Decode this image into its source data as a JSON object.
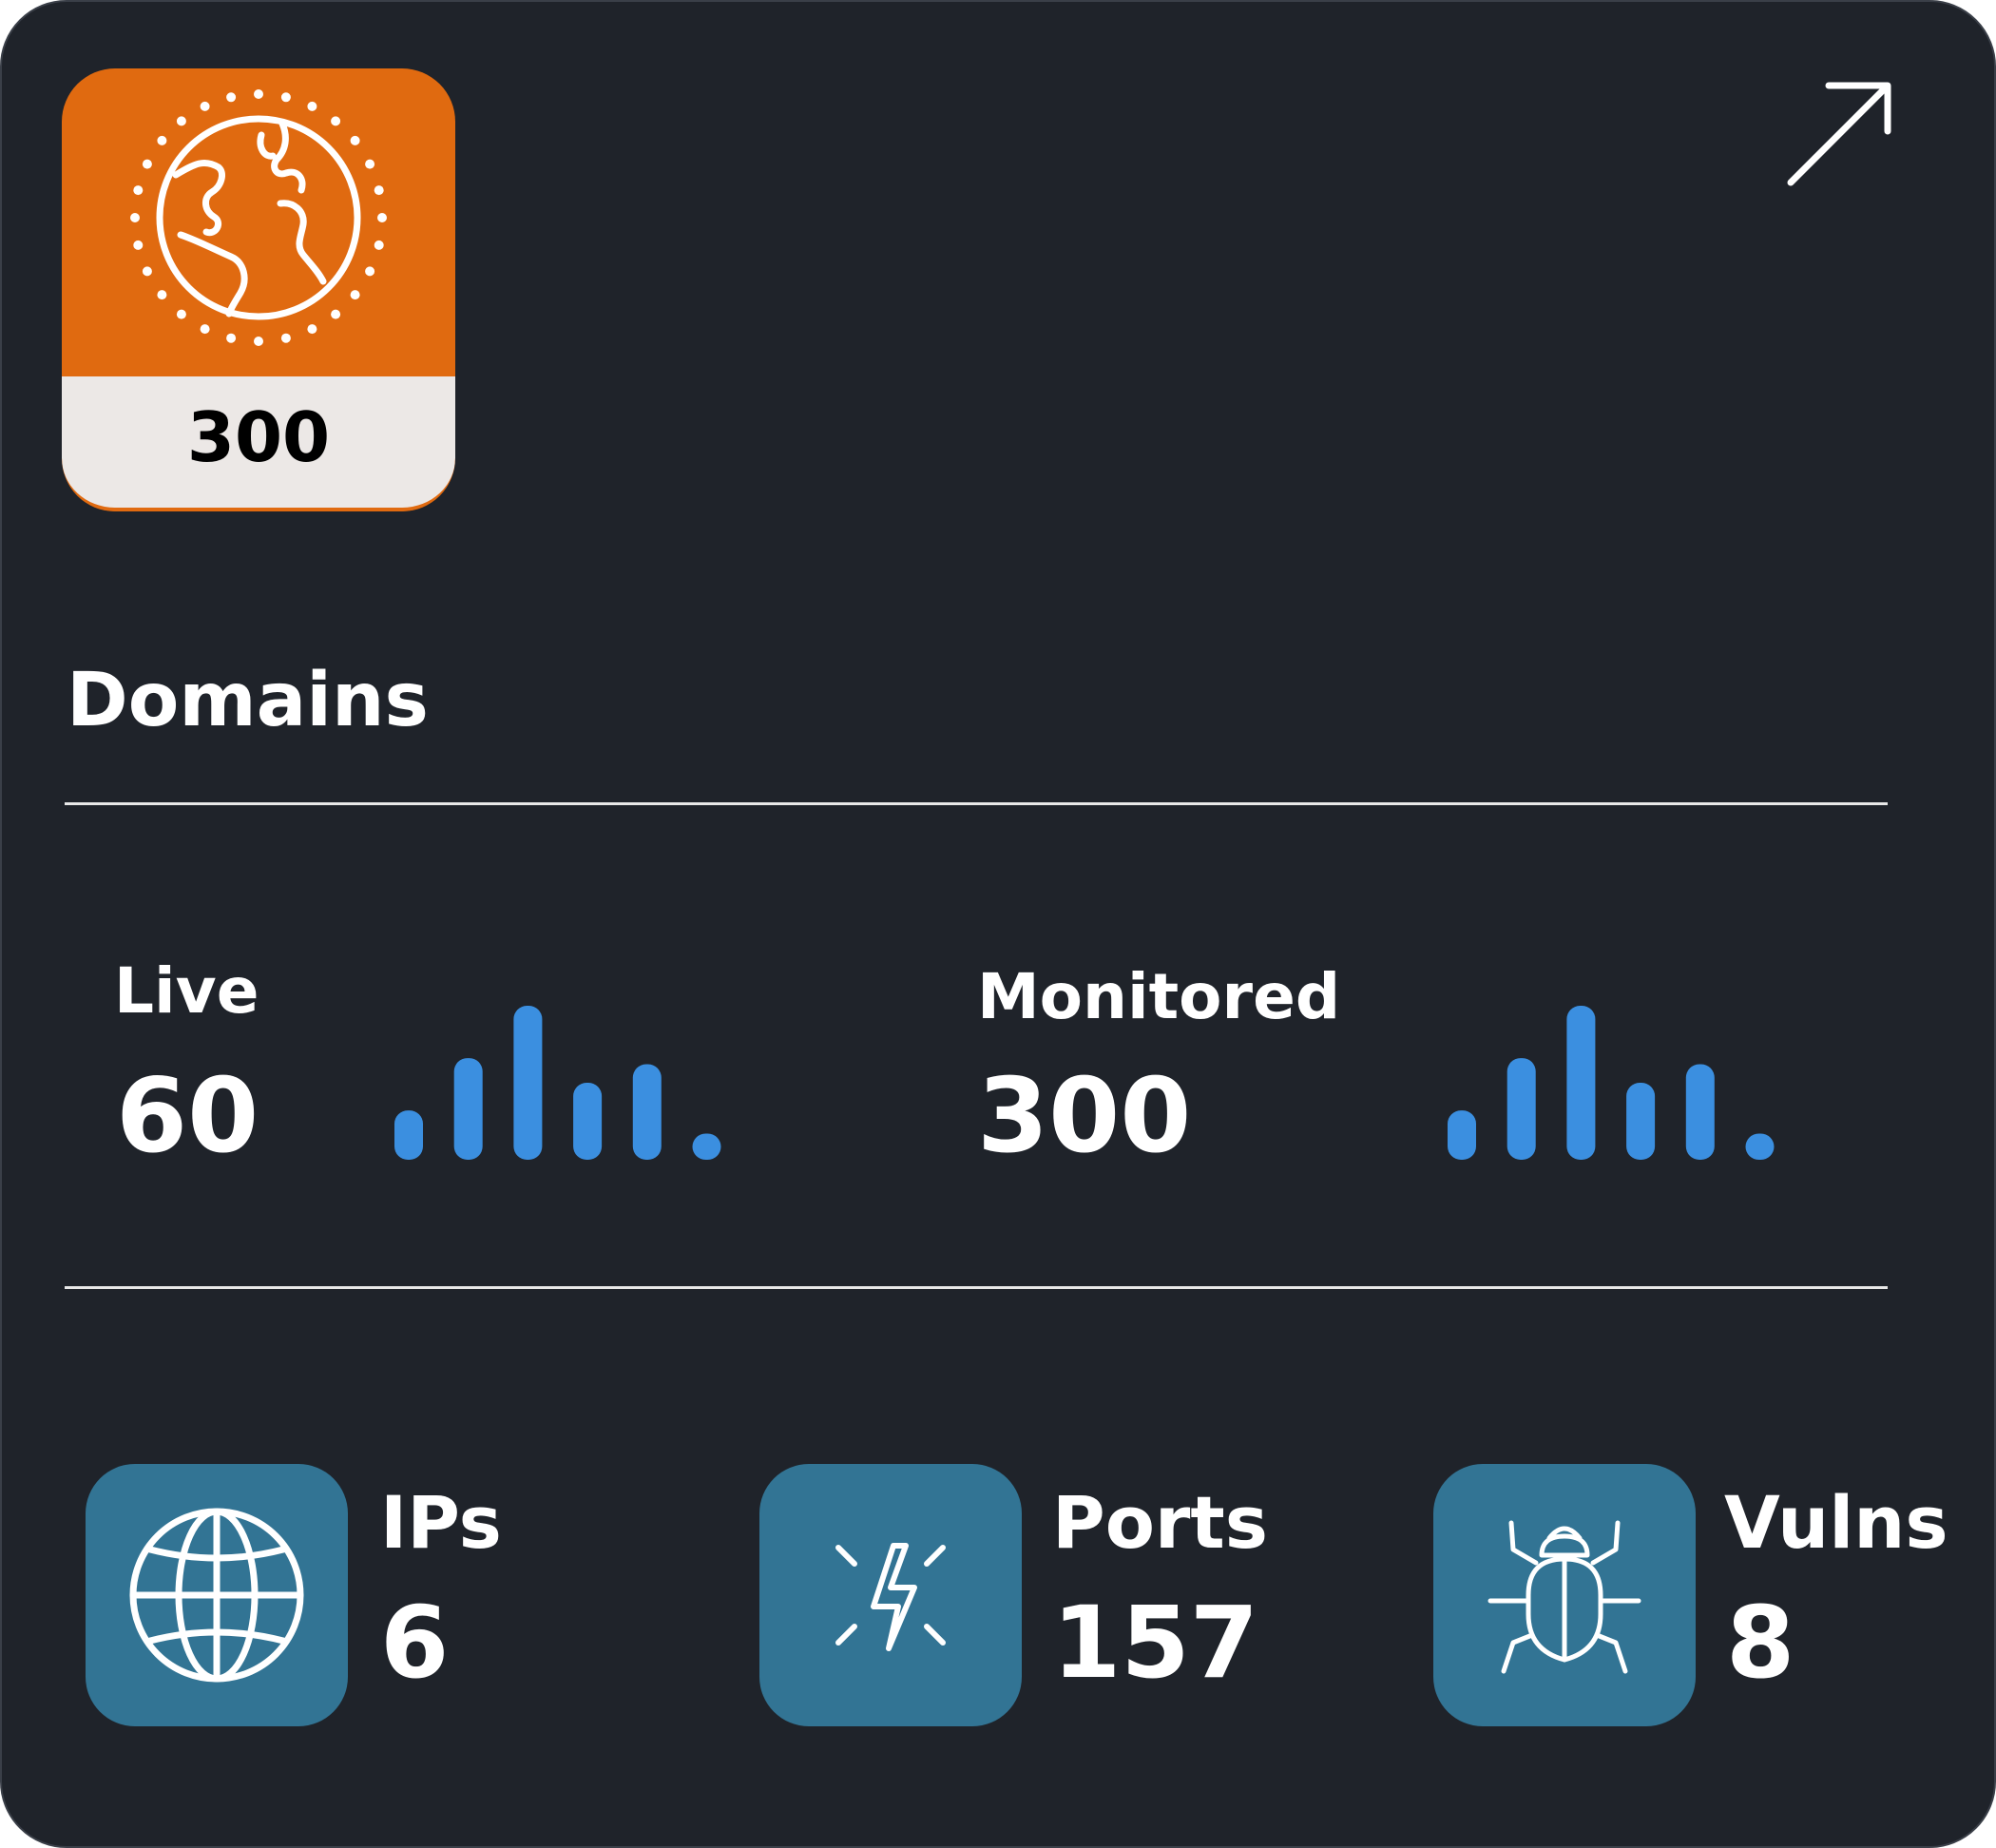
{
  "card": {
    "title": "Domains",
    "badge": {
      "icon": "globe-sparkle-icon",
      "count": "300",
      "color": "#e06a10"
    },
    "expand_icon": "arrow-up-right-icon"
  },
  "stats": [
    {
      "label": "Live",
      "value": "60",
      "trend": [
        0.32,
        0.66,
        1.0,
        0.5,
        0.62,
        0.17
      ]
    },
    {
      "label": "Monitored",
      "value": "300",
      "trend": [
        0.32,
        0.66,
        1.0,
        0.5,
        0.62,
        0.17
      ]
    }
  ],
  "trend_color": "#3b8fe0",
  "metrics": [
    {
      "label": "IPs",
      "value": "6",
      "icon": "globe-grid-icon"
    },
    {
      "label": "Ports",
      "value": "157",
      "icon": "lightning-icon"
    },
    {
      "label": "Vulns",
      "value": "8",
      "icon": "bug-icon"
    }
  ],
  "tile_color": "#327494"
}
